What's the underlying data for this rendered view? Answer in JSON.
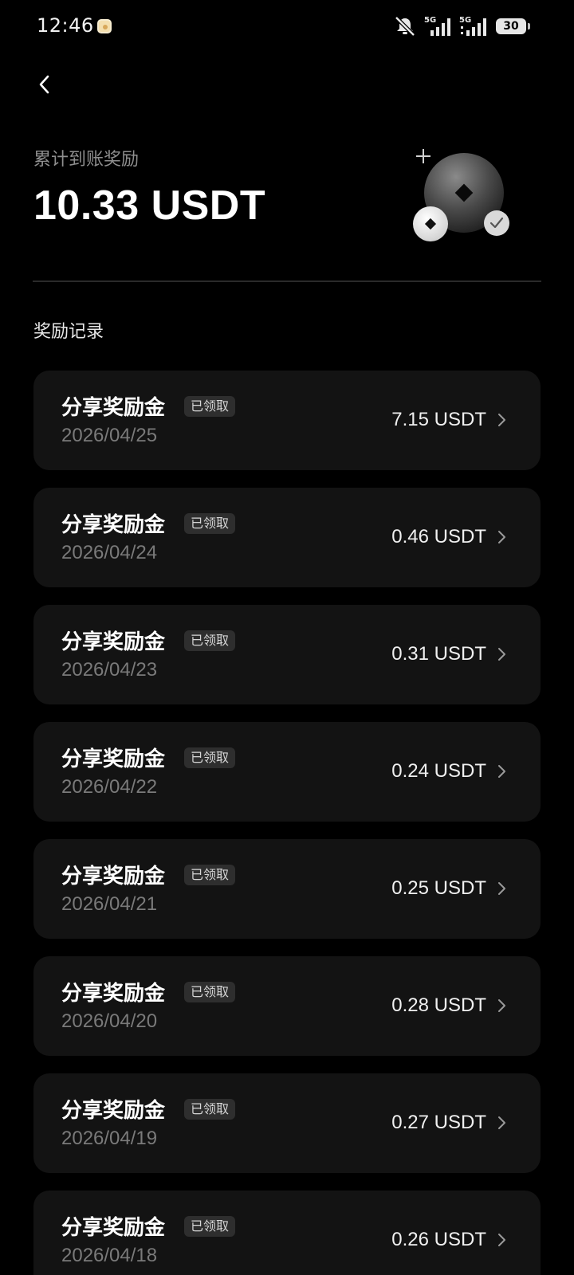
{
  "status_bar": {
    "time": "12:46",
    "network_1": "5G",
    "network_2": "5G",
    "battery": "30",
    "icons": [
      "app-notification-icon",
      "mute-bell-icon",
      "signal-5g-icon",
      "signal-5g-icon",
      "battery-icon"
    ]
  },
  "header": {
    "back_icon": "chevron-left-icon",
    "summary_label": "累计到账奖励",
    "summary_amount": "10.33 USDT",
    "illustration": "coin-reward-illustration"
  },
  "section_title": "奖励记录",
  "records": [
    {
      "title": "分享奖励金",
      "badge": "已领取",
      "date": "2026/04/25",
      "amount": "7.15 USDT"
    },
    {
      "title": "分享奖励金",
      "badge": "已领取",
      "date": "2026/04/24",
      "amount": "0.46 USDT"
    },
    {
      "title": "分享奖励金",
      "badge": "已领取",
      "date": "2026/04/23",
      "amount": "0.31 USDT"
    },
    {
      "title": "分享奖励金",
      "badge": "已领取",
      "date": "2026/04/22",
      "amount": "0.24 USDT"
    },
    {
      "title": "分享奖励金",
      "badge": "已领取",
      "date": "2026/04/21",
      "amount": "0.25 USDT"
    },
    {
      "title": "分享奖励金",
      "badge": "已领取",
      "date": "2026/04/20",
      "amount": "0.28 USDT"
    },
    {
      "title": "分享奖励金",
      "badge": "已领取",
      "date": "2026/04/19",
      "amount": "0.27 USDT"
    },
    {
      "title": "分享奖励金",
      "badge": "已领取",
      "date": "2026/04/18",
      "amount": "0.26 USDT"
    }
  ],
  "colors": {
    "background": "#000000",
    "card": "#131313",
    "badge": "#2e2e2e",
    "muted_text": "#7a7a7a"
  }
}
